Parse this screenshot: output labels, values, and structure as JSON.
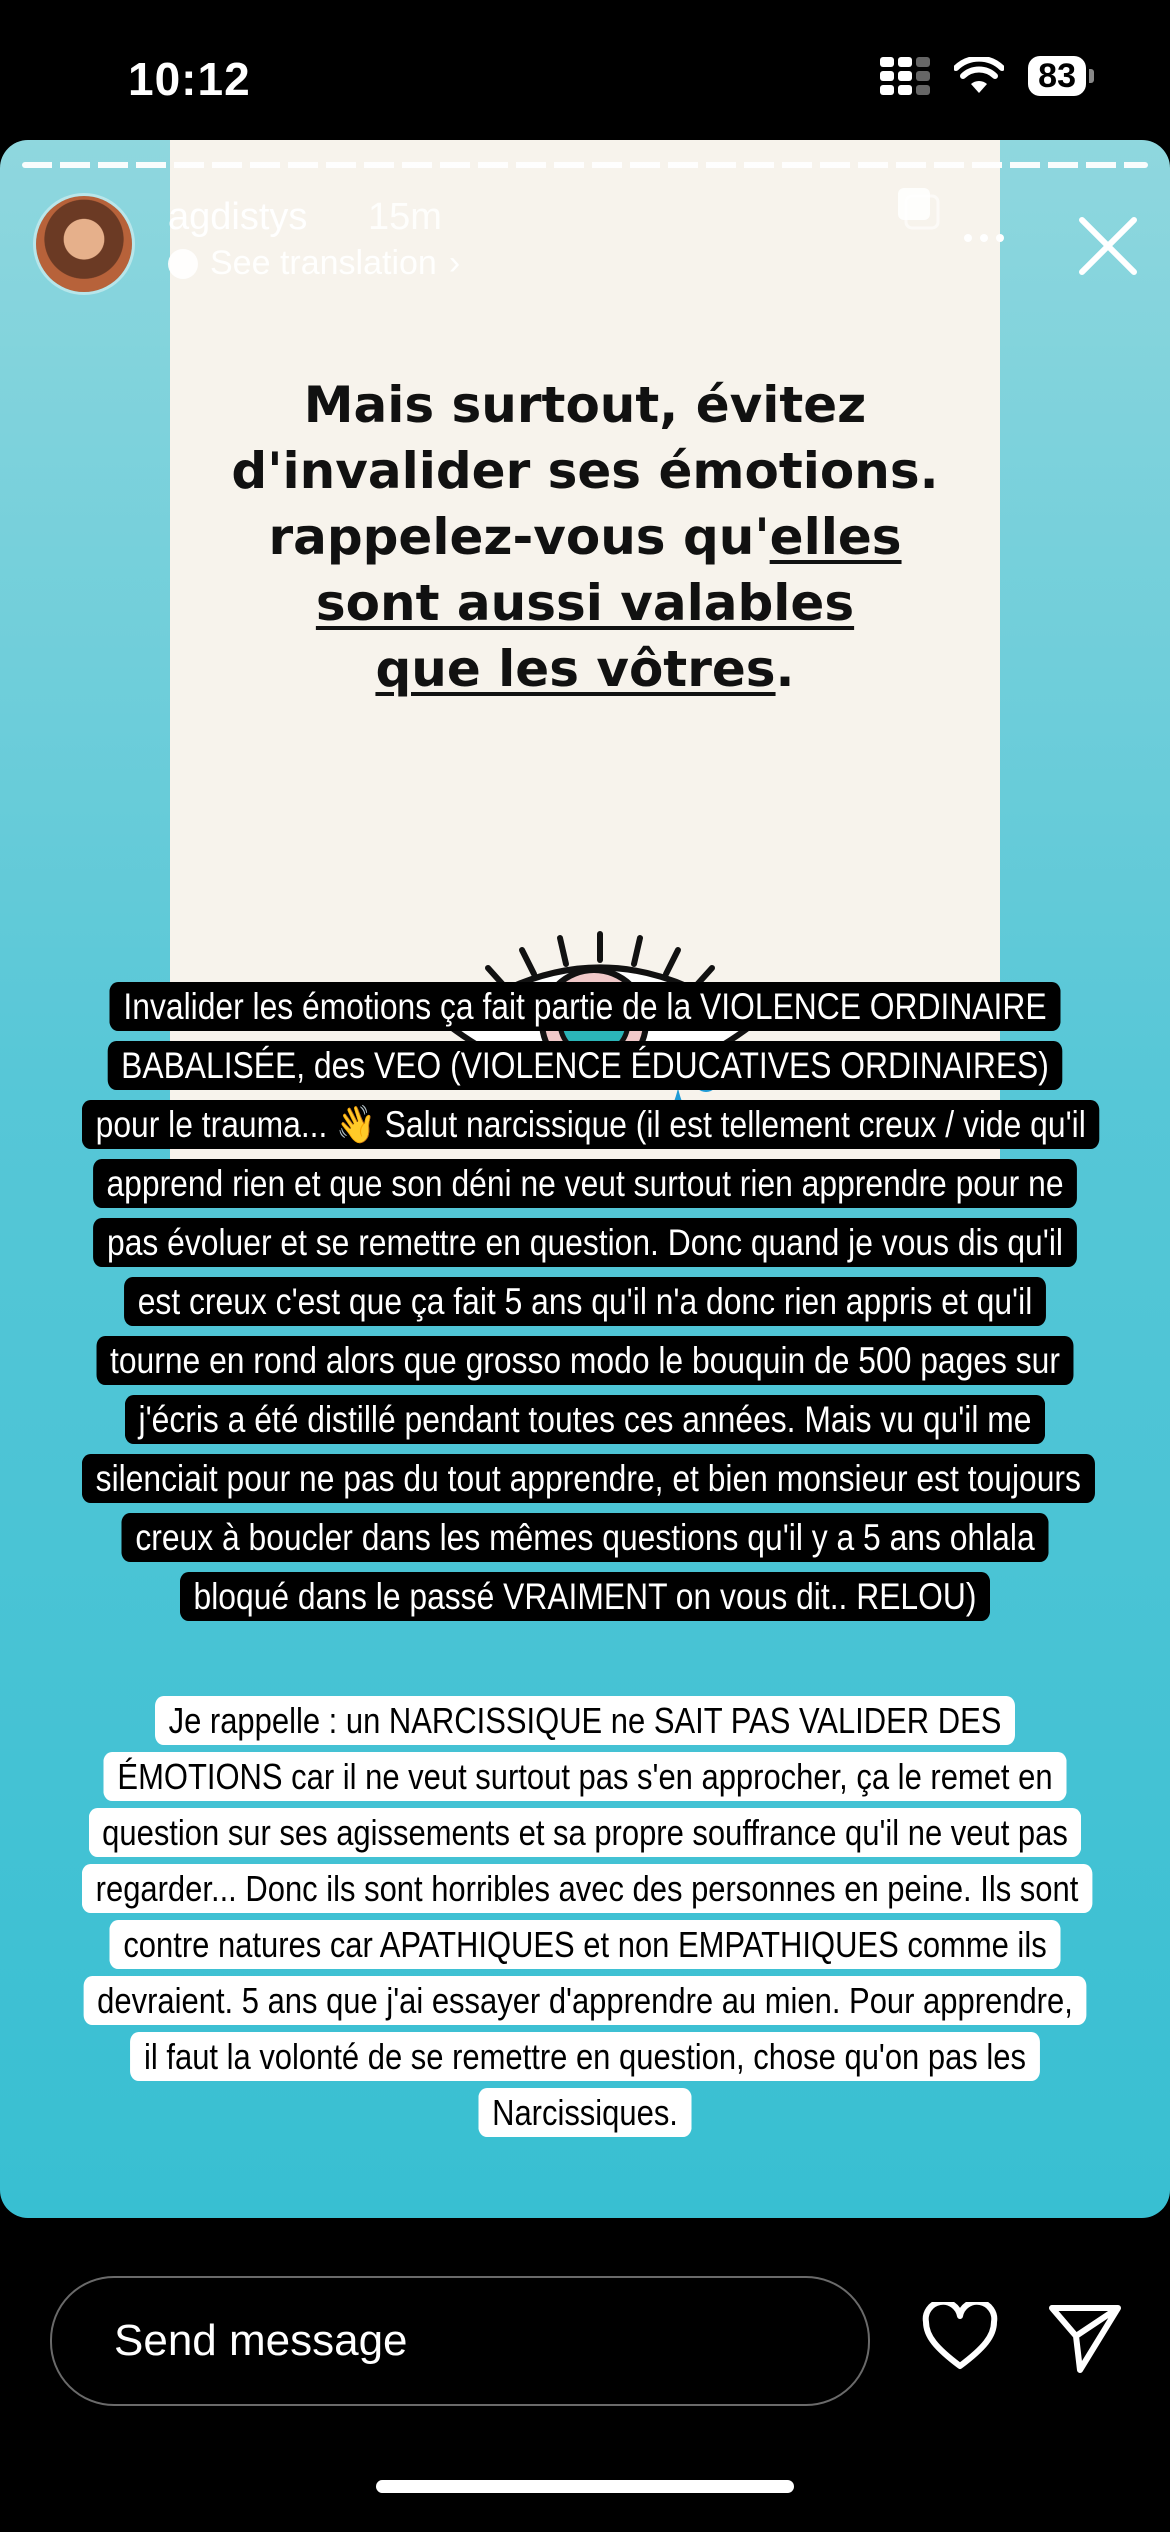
{
  "status_bar": {
    "time": "10:12",
    "battery": "83",
    "icons": [
      "cellular-icon",
      "wifi-icon",
      "battery-icon"
    ]
  },
  "story": {
    "username": "agdistys",
    "time_ago": "15m",
    "translation_label": "See translation",
    "slide": {
      "title_line1": "Mais surtout, évitez",
      "title_line2": "d'invalider ses émotions.",
      "title_line3_a": "rappelez-vous qu'",
      "title_line3_b": "elles",
      "title_line4": "sont aussi valables",
      "title_line5_a": "que les vôtres",
      "title_line5_b": "."
    },
    "caption_dark": "Invalider les émotions ça fait partie de la VIOLENCE ORDINAIRE BABALISÉE, des VEO (VIOLENCE ÉDUCATIVES ORDINAIRES) pour le trauma... 👋 Salut narcissique (il est tellement creux / vide qu'il apprend rien et que son déni ne veut surtout rien apprendre pour ne pas évoluer et se remettre en question. Donc quand je vous dis qu'il est creux c'est que ça fait 5 ans qu'il n'a donc rien appris et qu'il tourne en rond alors que grosso modo le bouquin de 500 pages sur j'écris a été distillé pendant toutes ces années. Mais vu qu'il me silenciait pour ne pas du tout apprendre, et bien monsieur est toujours creux à boucler dans les mêmes questions qu'il y a 5 ans ohlala bloqué dans le passé VRAIMENT on vous dit.. RELOU)",
    "caption_light": "Je rappelle : un NARCISSIQUE ne SAIT PAS VALIDER DES ÉMOTIONS car il ne veut surtout pas s'en approcher, ça le remet en question sur ses agissements et sa propre souffrance qu'il ne veut pas regarder... Donc ils sont horribles avec des personnes en peine. Ils sont contre natures car APATHIQUES et non EMPATHIQUES comme ils devraient. 5 ans que j'ai essayer d'apprendre au mien. Pour apprendre, il faut la volonté de se remettre en question, chose qu'on pas les Narcissiques."
  },
  "bottom_bar": {
    "message_placeholder": "Send message"
  },
  "colors": {
    "story_bg": "#4cc4d5",
    "panel_bg": "#f7f3ec",
    "eye_iris": "#2bb5b8",
    "tear": "#1f9bd6"
  }
}
